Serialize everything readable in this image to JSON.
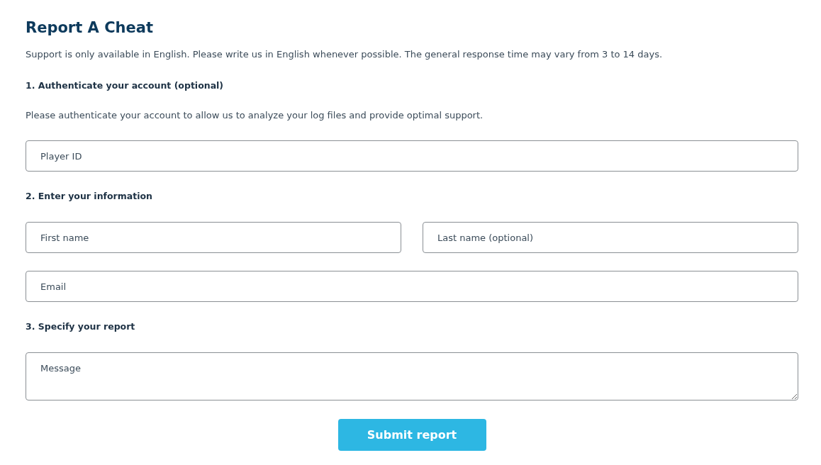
{
  "title": "Report A Cheat",
  "intro": "Support is only available in English. Please write us in English whenever possible. The general response time may vary from 3 to 14 days.",
  "sections": [
    {
      "heading": "1.  Authenticate your account (optional)",
      "description": "Please authenticate your account to allow us to analyze your log files and provide optimal support.",
      "rows": [
        [
          {
            "kind": "input",
            "placeholder": "Player ID"
          }
        ]
      ]
    },
    {
      "heading": "2.  Enter your information",
      "rows": [
        [
          {
            "kind": "input",
            "placeholder": "First name"
          },
          {
            "kind": "input",
            "placeholder": "Last name (optional)"
          }
        ],
        [
          {
            "kind": "input",
            "placeholder": "Email"
          }
        ]
      ]
    },
    {
      "heading": "3.  Specify your report",
      "rows": [
        [
          {
            "kind": "textarea",
            "placeholder": "Message"
          }
        ]
      ]
    }
  ],
  "submit_button": "Submit report"
}
